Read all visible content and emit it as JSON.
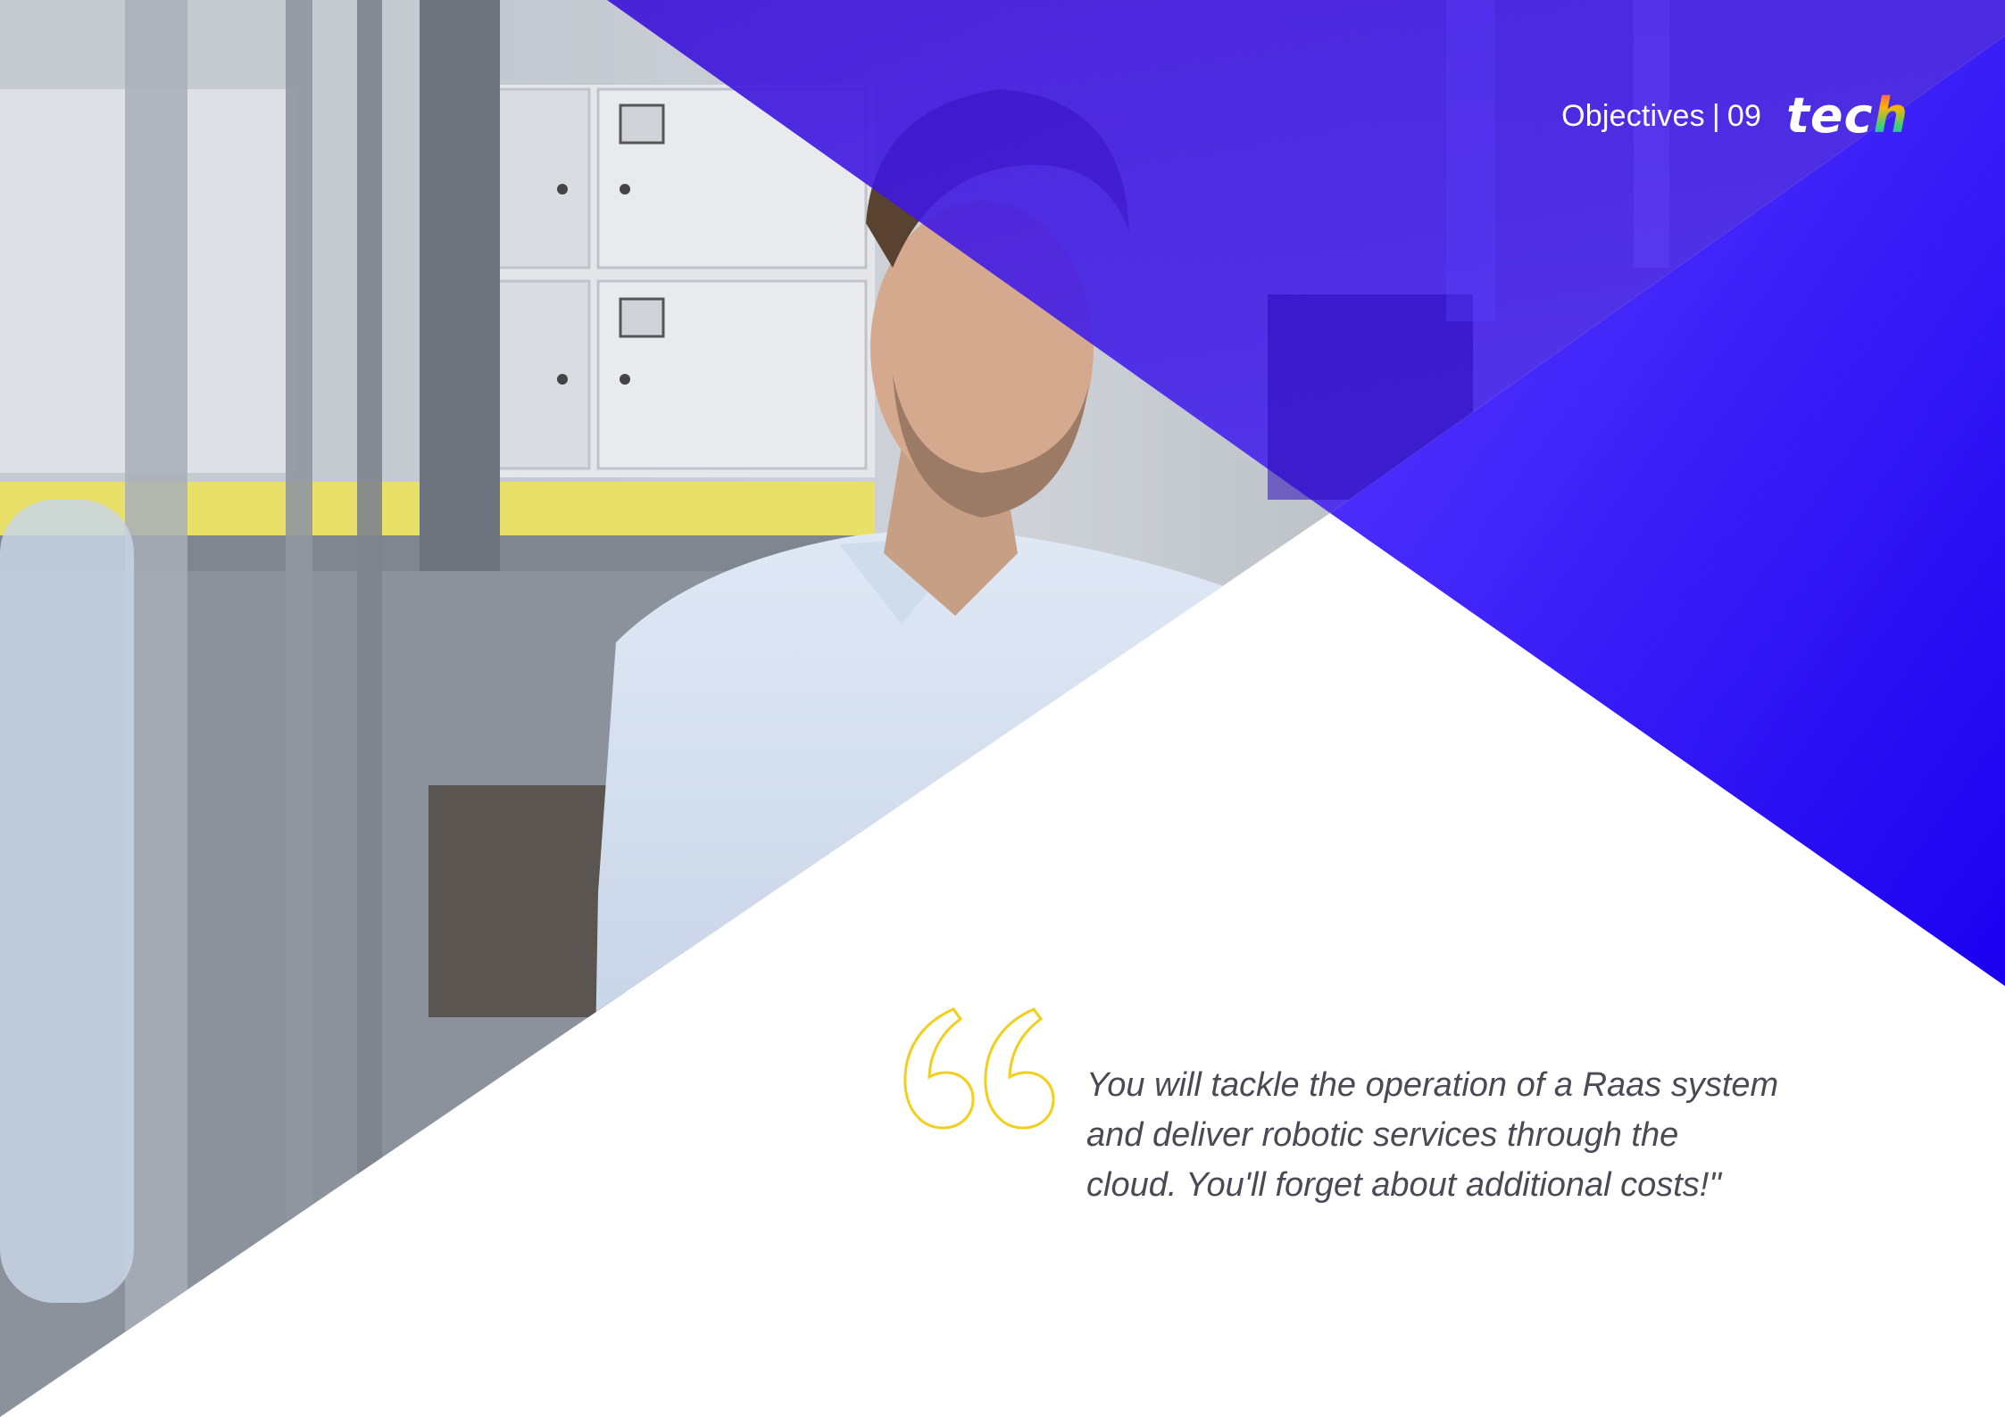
{
  "header": {
    "section_label": "Objectives",
    "separator": "|",
    "page_number": "09",
    "logo_text_main": "tec",
    "logo_text_last": "h"
  },
  "quote": {
    "lines": [
      "You will tackle the operation of a Raas system",
      "and deliver robotic services through the",
      "cloud. You'll forget about additional costs!\""
    ]
  },
  "colors": {
    "brand_blue": "#3d16f2",
    "quote_mark_yellow": "#f2cf1c",
    "text_gray": "#4a4a55",
    "background": "#ffffff"
  },
  "icons": {
    "quote_mark": "open-double-quote-icon"
  }
}
